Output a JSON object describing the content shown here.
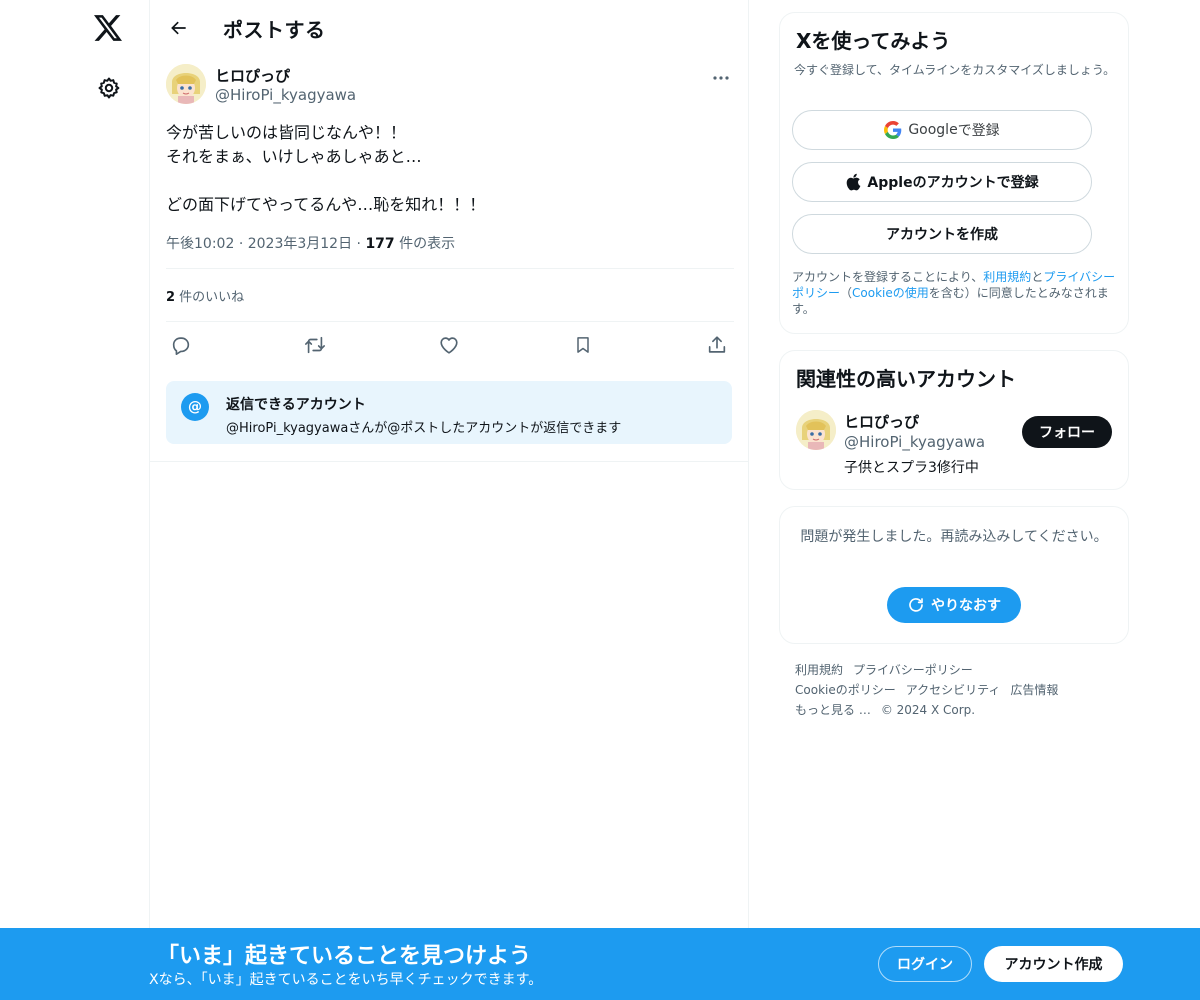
{
  "header": {
    "title": "ポストする"
  },
  "post": {
    "author_name": "ヒロぴっぴ",
    "author_handle": "@HiroPi_kyagyawa",
    "lines": [
      "今が苦しいのは皆同じなんや！！",
      "それをまぁ、いけしゃあしゃあと…",
      "",
      "どの面下げてやってるんや…恥を知れ！！！"
    ],
    "time": "午後10:02",
    "date": "2023年3月12日",
    "views_count": "177",
    "views_label": " 件の表示",
    "likes_count": "2",
    "likes_label": " 件のいいね",
    "reply_title": "返信できるアカウント",
    "reply_desc": "@HiroPi_kyagyawaさんが@ポストしたアカウントが返信できます"
  },
  "signup_card": {
    "title": "Xを使ってみよう",
    "subtitle": "今すぐ登録して、タイムラインをカスタマイズしましょう。",
    "google_label": "Google",
    "google_suffix": " で登録",
    "apple_label": "Appleのアカウントで登録",
    "create_label": "アカウントを作成",
    "legal_1": "アカウントを登録することにより、",
    "legal_terms": "利用規約",
    "legal_2": "と",
    "legal_privacy": "プライバシーポリシー",
    "legal_3": "（",
    "legal_cookie": "Cookieの使用",
    "legal_4": "を含む）に同意したとみなされます。"
  },
  "relevant": {
    "title": "関連性の高いアカウント",
    "name": "ヒロぴっぴ",
    "handle": "@HiroPi_kyagyawa",
    "bio": "子供とスプラ3修行中",
    "follow_label": "フォロー"
  },
  "error_card": {
    "message": "問題が発生しました。再読み込みしてください。",
    "retry_label": "やりなおす"
  },
  "footer": {
    "row1": [
      "利用規約",
      "プライバシーポリシー"
    ],
    "row2": [
      "Cookieのポリシー",
      "アクセシビリティ",
      "広告情報"
    ],
    "row3": [
      "もっと見る …",
      "© 2024 X Corp."
    ]
  },
  "banner": {
    "title": "「いま」起きていることを見つけよう",
    "subtitle": "Xなら、「いま」起きていることをいち早くチェックできます。",
    "login_label": "ログイン",
    "signup_label": "アカウント作成"
  },
  "colors": {
    "accent": "#1d9bf0",
    "text": "#0f1419",
    "secondary": "#536471",
    "border": "#eff3f4"
  },
  "icons": [
    "x-logo-icon",
    "gear-icon",
    "back-arrow-icon",
    "more-icon",
    "reply-icon",
    "retweet-icon",
    "like-icon",
    "bookmark-icon",
    "share-icon",
    "at-icon",
    "google-icon",
    "apple-icon",
    "refresh-icon"
  ]
}
